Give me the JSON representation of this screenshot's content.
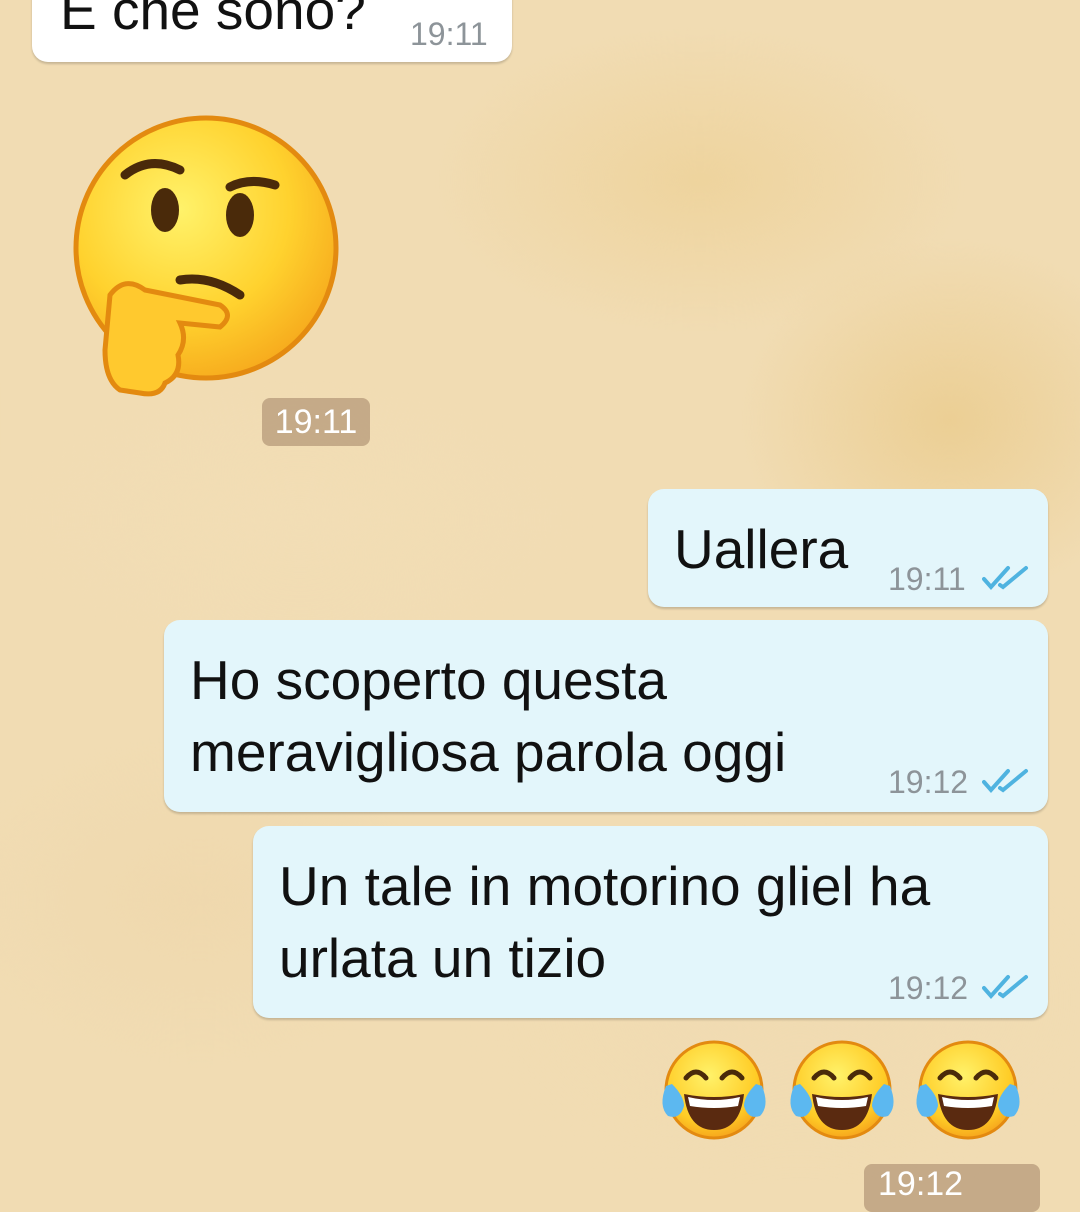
{
  "messages": {
    "incoming_top": {
      "text": "E che sono?",
      "time": "19:11"
    },
    "sticker": {
      "icon": "thinking-face-emoji",
      "time": "19:11"
    },
    "out1": {
      "text": "Uallera",
      "time": "19:11",
      "status_icon": "double-check-icon"
    },
    "out2": {
      "line1": "Ho scoperto questa",
      "line2": "meravigliosa parola oggi",
      "time": "19:12",
      "status_icon": "double-check-icon"
    },
    "out3": {
      "line1": "Un tale in motorino gliel ha",
      "line2": "urlata un tizio",
      "time": "19:12",
      "status_icon": "double-check-icon"
    },
    "emoji_row": {
      "icons": [
        "face-with-tears-of-joy-emoji",
        "face-with-tears-of-joy-emoji",
        "face-with-tears-of-joy-emoji"
      ],
      "time": "19:12"
    }
  },
  "colors": {
    "tick": "#4fb3e0",
    "incoming_bubble": "#ffffff",
    "outgoing_bubble": "#e3f6fb"
  }
}
